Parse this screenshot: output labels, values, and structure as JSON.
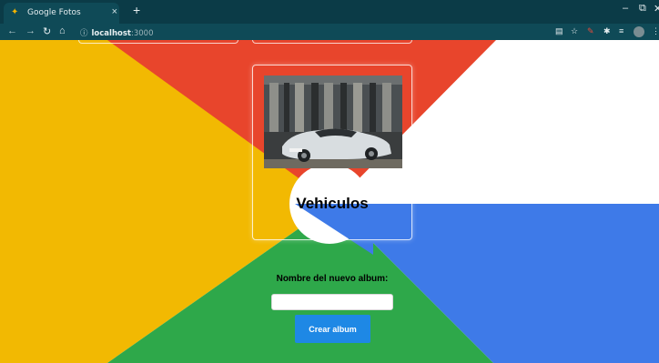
{
  "browser": {
    "tab_title": "Google Fotos",
    "tab_close": "×",
    "new_tab": "+",
    "url_host": "localhost",
    "url_port": ":3000",
    "colors": {
      "tabbar": "#0b3b47",
      "toolbar": "#0f4a57"
    }
  },
  "background": {
    "colors": {
      "red": "#e8452c",
      "yellow": "#f2b902",
      "green": "#2ea84a",
      "blue": "#3e7ae8",
      "white": "#ffffff"
    }
  },
  "album": {
    "title": "Vehiculos",
    "photo_icon": "sports-car-photo"
  },
  "form": {
    "label": "Nombre del nuevo album:",
    "input_value": "",
    "input_placeholder": "",
    "button_label": "Crear album"
  }
}
